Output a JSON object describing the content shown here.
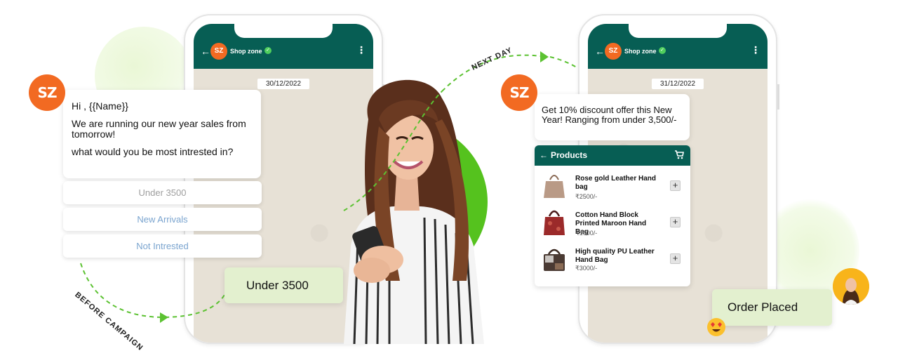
{
  "colors": {
    "whatsapp_header": "#075e54",
    "brand_orange": "#f26a22",
    "accent_green": "#55c21e",
    "reply_bubble": "#e3f0cf"
  },
  "brand": {
    "logo_text": "SZ"
  },
  "left_phone": {
    "shop_name": "Shop zone",
    "date": "30/12/2022",
    "icons": [
      "back-arrow-icon",
      "verified-icon",
      "more-vert-icon"
    ]
  },
  "right_phone": {
    "shop_name": "Shop zone",
    "date": "31/12/2022",
    "icons": [
      "back-arrow-icon",
      "verified-icon",
      "more-vert-icon"
    ]
  },
  "campaign_message": {
    "greeting": "Hi , {{Name}}",
    "line1": "We are running our new year sales from tomorrow!",
    "line2": "what would you be most intrested in?"
  },
  "quick_replies": [
    {
      "label": "Under 3500"
    },
    {
      "label": "New Arrivals"
    },
    {
      "label": "Not Intrested"
    }
  ],
  "user_reply": "Under 3500",
  "labels": {
    "before_campaign": "BEFORE CAMPAIGN",
    "next_day": "NEXT DAY"
  },
  "offer_message": "Get 10% discount offer this New Year! Ranging from under 3,500/-",
  "products": {
    "title": "Products",
    "items": [
      {
        "name": "Rose gold Leather Hand bag",
        "price": "₹2500/-",
        "add": "+"
      },
      {
        "name": "Cotton Hand Block Printed Maroon Hand Bag",
        "price": "₹1000/-",
        "add": "+"
      },
      {
        "name": "High quality PU Leather Hand Bag",
        "price": "₹3000/-",
        "add": "+"
      }
    ]
  },
  "order_status": "Order Placed"
}
